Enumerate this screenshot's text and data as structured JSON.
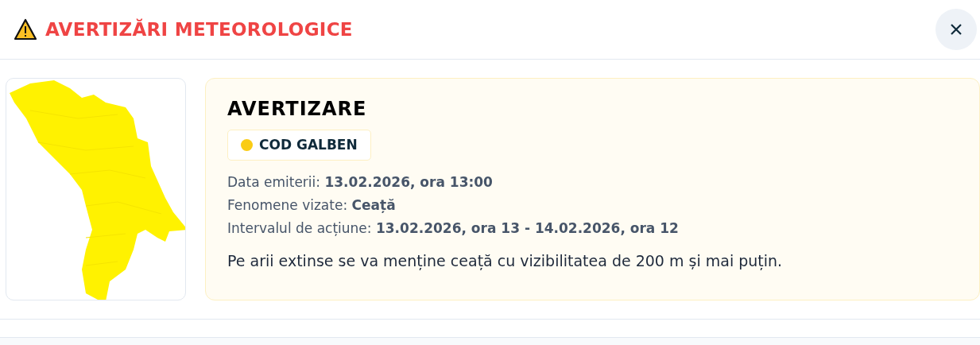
{
  "header": {
    "title": "AVERTIZĂRI METEOROLOGICE"
  },
  "warning": {
    "heading": "AVERTIZARE",
    "code": {
      "label": "COD GALBEN",
      "color": "#facc15"
    },
    "details": [
      "Data emiterii: **13.02.2026, ora 13:00**",
      "Fenomene vizate: **Ceață**",
      "Intervalul de acțiune: **13.02.2026, ora 13 - 14.02.2026, ora 12**"
    ],
    "description": "Pe arii extinse se va menține ceață cu vizibilitatea de 200 m și mai puțin."
  }
}
